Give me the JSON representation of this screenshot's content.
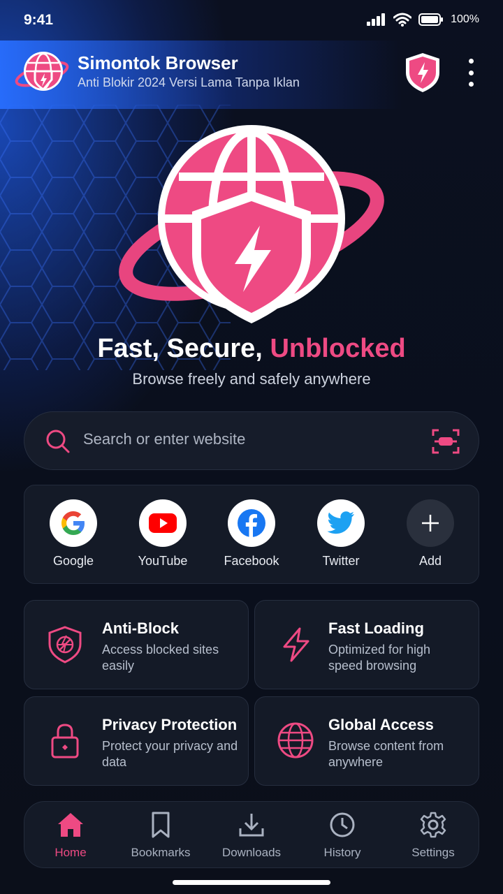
{
  "status_bar": {
    "time": "9:41",
    "battery": "100%"
  },
  "app": {
    "title": "Simontok Browser",
    "subtitle": "Anti Blokir 2024 Versi Lama Tanpa Iklan"
  },
  "hero": {
    "tagline_main": "Fast, Secure, ",
    "tagline_accent": "Unblocked",
    "subtagline": "Browse freely and safely anywhere"
  },
  "search": {
    "placeholder": "Search or enter website",
    "value": ""
  },
  "quick_links": [
    {
      "label": "Google",
      "icon": "google-icon"
    },
    {
      "label": "YouTube",
      "icon": "youtube-icon"
    },
    {
      "label": "Facebook",
      "icon": "facebook-icon"
    },
    {
      "label": "Twitter",
      "icon": "twitter-icon"
    },
    {
      "label": "Add",
      "icon": "plus-icon"
    }
  ],
  "features": [
    {
      "title": "Anti-Block",
      "desc": "Access blocked sites easily",
      "icon": "shield-block-icon"
    },
    {
      "title": "Fast Loading",
      "desc": "Optimized for high speed browsing",
      "icon": "lightning-icon"
    },
    {
      "title": "Privacy Protection",
      "desc": "Protect your privacy and data",
      "icon": "lock-icon"
    },
    {
      "title": "Global Access",
      "desc": "Browse content from anywhere",
      "icon": "globe-icon"
    }
  ],
  "nav": [
    {
      "label": "Home",
      "icon": "home-icon",
      "active": true
    },
    {
      "label": "Bookmarks",
      "icon": "bookmark-icon",
      "active": false
    },
    {
      "label": "Downloads",
      "icon": "download-icon",
      "active": false
    },
    {
      "label": "History",
      "icon": "clock-icon",
      "active": false
    },
    {
      "label": "Settings",
      "icon": "gear-icon",
      "active": false
    }
  ],
  "colors": {
    "accent": "#ee4a83",
    "background": "#0a0f1c",
    "card": "#141a27",
    "header_blue": "#2a6cff"
  }
}
